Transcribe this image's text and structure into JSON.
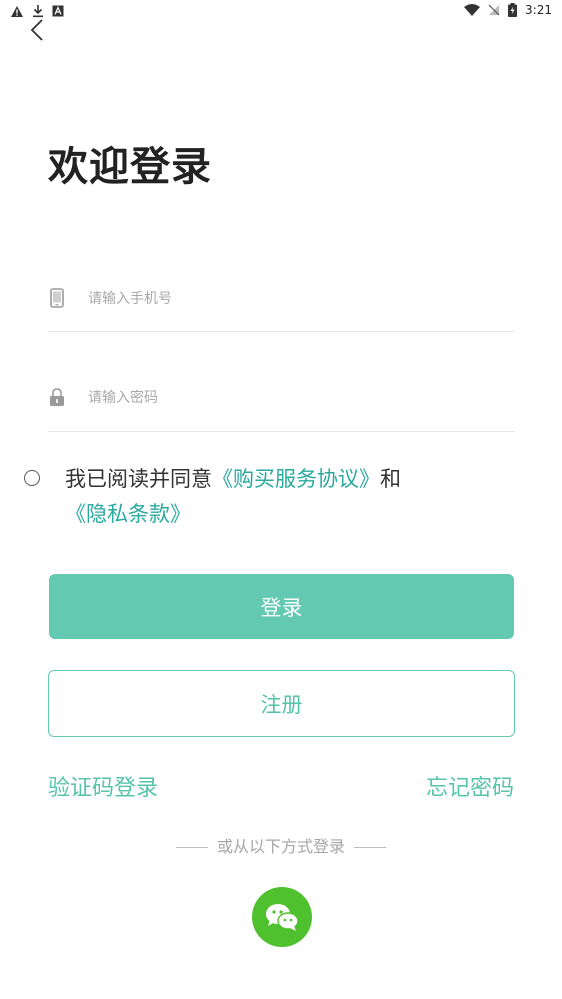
{
  "status_bar": {
    "time": "3:21",
    "left_icons": [
      "alert-icon",
      "download-icon",
      "a-icon"
    ],
    "right_icons": [
      "wifi-icon",
      "no-signal-icon",
      "battery-charging-icon"
    ]
  },
  "header": {
    "title": "欢迎登录"
  },
  "form": {
    "phone_placeholder": "请输入手机号",
    "password_placeholder": "请输入密码"
  },
  "agreement": {
    "prefix": "我已阅读并同意",
    "link1": "《购买服务协议》",
    "middle": "和",
    "link2": "《隐私条款》"
  },
  "buttons": {
    "login": "登录",
    "register": "注册"
  },
  "links": {
    "sms_login": "验证码登录",
    "forgot_password": "忘记密码"
  },
  "other_login": {
    "label": "或从以下方式登录"
  },
  "colors": {
    "accent": "#63c9b0",
    "link": "#2aa9a0",
    "wechat": "#50c12e"
  }
}
